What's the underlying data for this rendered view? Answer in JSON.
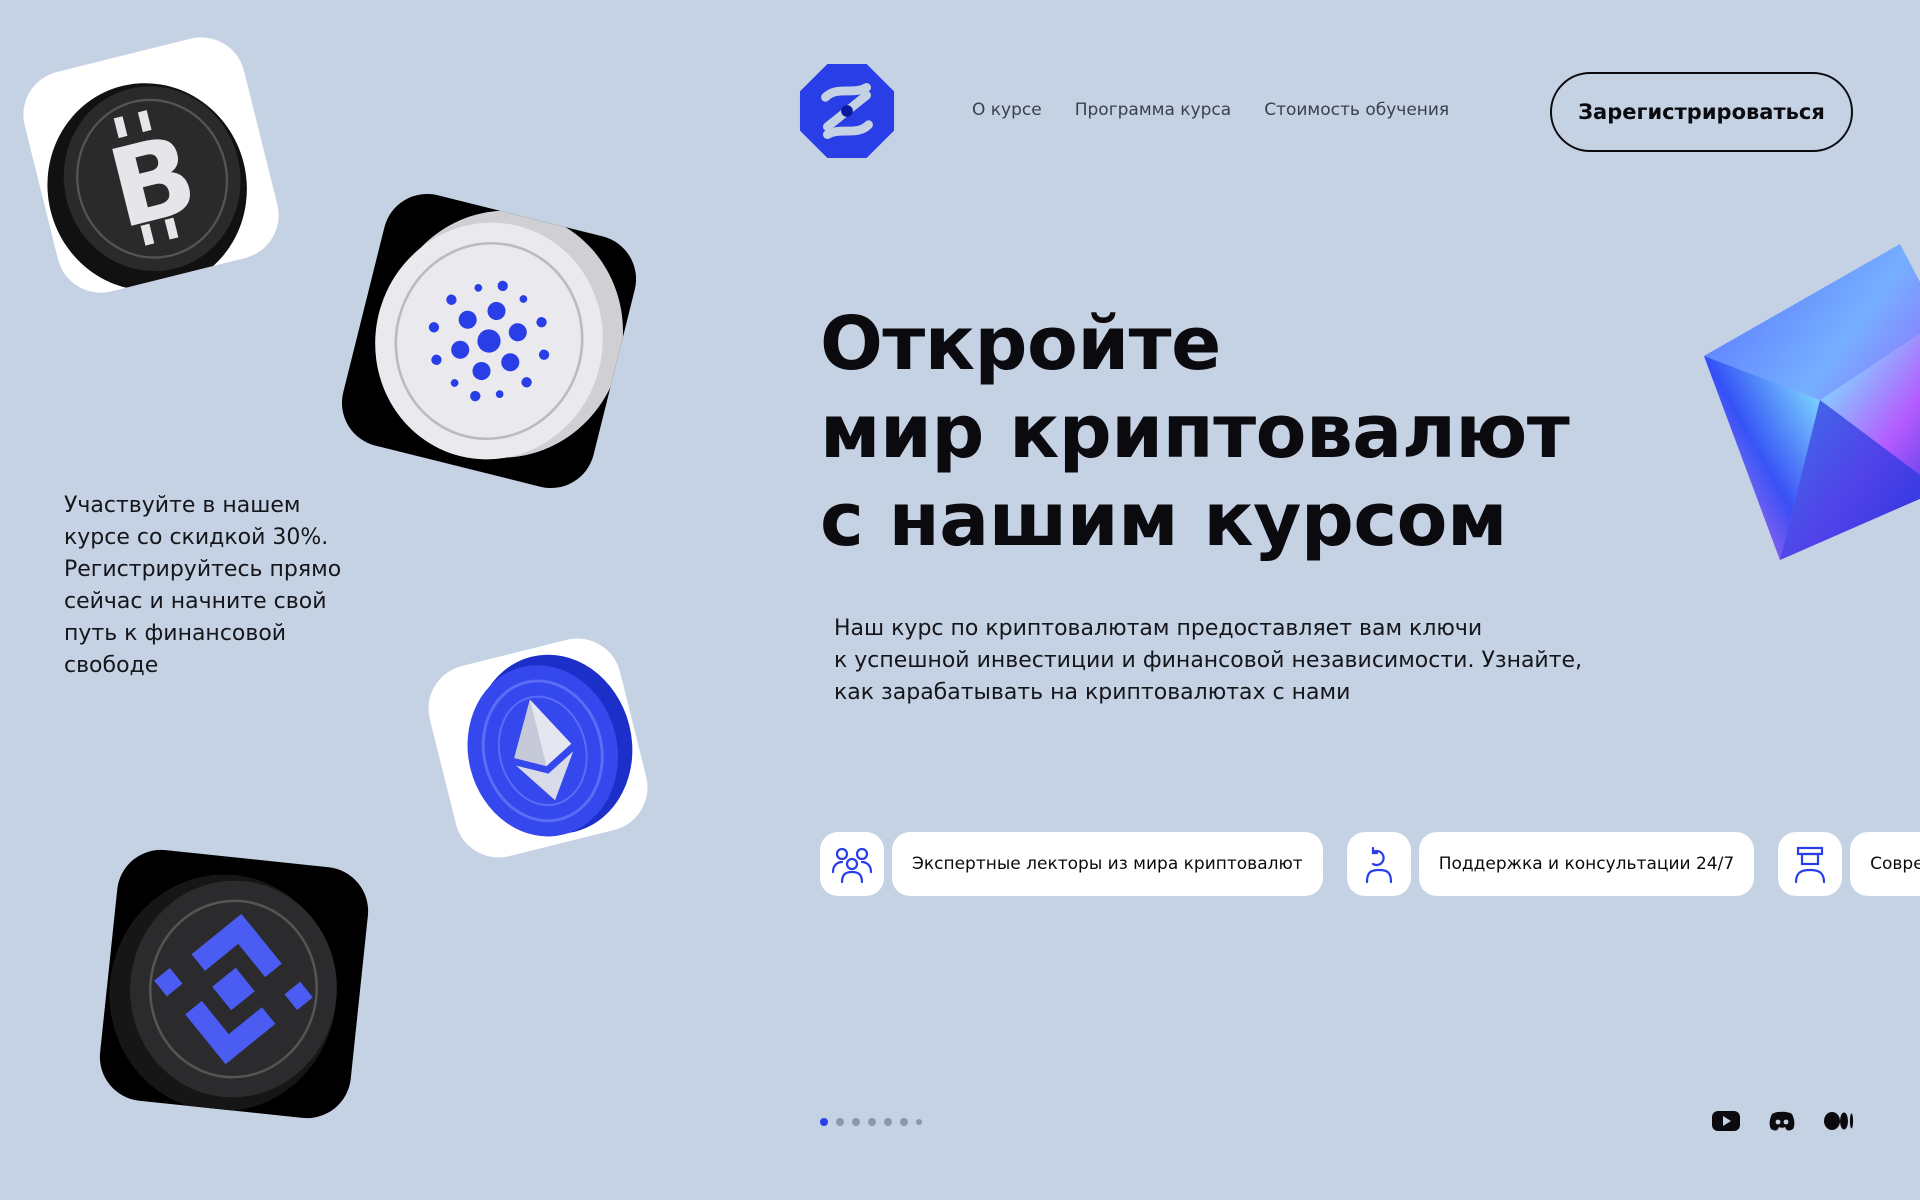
{
  "header": {
    "logo_icon": "brand-logo-icon",
    "nav": [
      "О курсе",
      "Программа курса",
      "Стоимость обучения"
    ],
    "register_label": "Зарегистрироваться"
  },
  "hero": {
    "title_lines": [
      "Откройте",
      "мир криптовалют",
      "с нашим курсом"
    ],
    "description_lines": [
      "Наш курс по криптовалютам предоставляет вам ключи",
      "к успешной инвестиции и финансовой независимости. Узнайте,",
      "как зарабатывать на криптовалютах с нами"
    ]
  },
  "promo": {
    "lines": [
      "Участвуйте в нашем",
      "курсе со скидкой 30%.",
      "Регистрируйтесь прямо",
      "сейчас и начните свой",
      "путь к финансовой",
      "свободе"
    ]
  },
  "features": [
    {
      "icon": "lecturers-icon",
      "label": "Экспертные лекторы из мира криптовалют"
    },
    {
      "icon": "support-icon",
      "label": "Поддержка и консультации 24/7"
    },
    {
      "icon": "modern-icon",
      "label": "Современ"
    }
  ],
  "pager": {
    "count": 7,
    "active_index": 0
  },
  "socials": [
    "youtube-icon",
    "discord-icon",
    "medium-icon"
  ],
  "colors": {
    "background": "#c5d2e4",
    "accent": "#2a3ee8",
    "text": "#0b0b0f"
  },
  "coins": [
    "bitcoin-coin-icon",
    "cardano-coin-icon",
    "ethereum-coin-icon",
    "bnb-coin-icon"
  ]
}
